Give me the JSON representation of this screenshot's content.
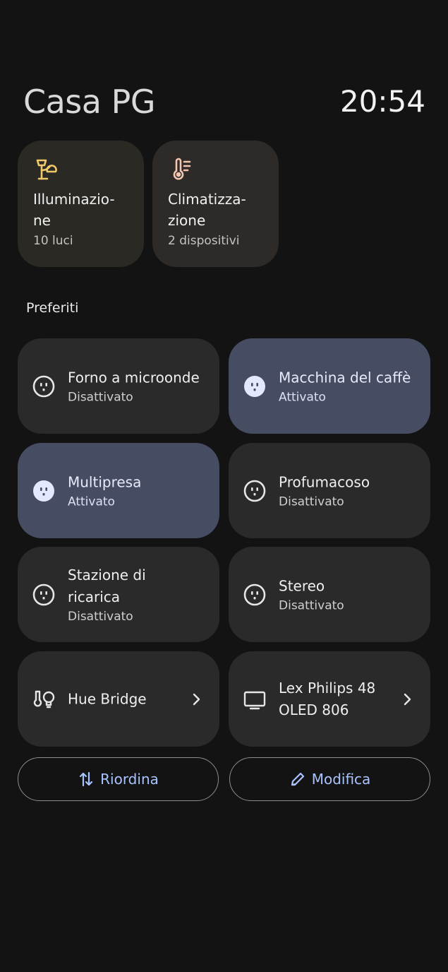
{
  "header": {
    "title": "Casa PG",
    "time": "20:54"
  },
  "categories": [
    {
      "label": "Illuminazio-\nne",
      "subtitle": "10 luci",
      "icon": "lamp-icon",
      "color": "#f0c96a"
    },
    {
      "label": "Climatizza-\nzione",
      "subtitle": "2 dispositivi",
      "icon": "thermostat-icon",
      "color": "#f4c6b2"
    }
  ],
  "favorites": {
    "label": "Preferiti",
    "tiles": [
      {
        "name": "Forno a microonde",
        "state": "Disattivato",
        "on": false,
        "icon": "outlet-icon"
      },
      {
        "name": "Macchina del caffè",
        "state": "Attivato",
        "on": true,
        "icon": "outlet-icon"
      },
      {
        "name": "Multipresa",
        "state": "Attivato",
        "on": true,
        "icon": "outlet-icon"
      },
      {
        "name": "Profumacoso",
        "state": "Disattivato",
        "on": false,
        "icon": "outlet-icon"
      },
      {
        "name": "Stazione di ricarica",
        "state": "Disattivato",
        "on": false,
        "icon": "outlet-icon"
      },
      {
        "name": "Stereo",
        "state": "Disattivato",
        "on": false,
        "icon": "outlet-icon"
      },
      {
        "name": "Hue Bridge",
        "icon": "hub-icon"
      },
      {
        "name": "Lex Philips 48 OLED 806",
        "icon": "tv-icon"
      }
    ]
  },
  "actions": {
    "reorder": "Riordina",
    "edit": "Modifica"
  },
  "colors": {
    "background": "#131313",
    "tile": "#2a2a2b",
    "tile_on": "#464c62",
    "accent": "#a9c3ff"
  }
}
